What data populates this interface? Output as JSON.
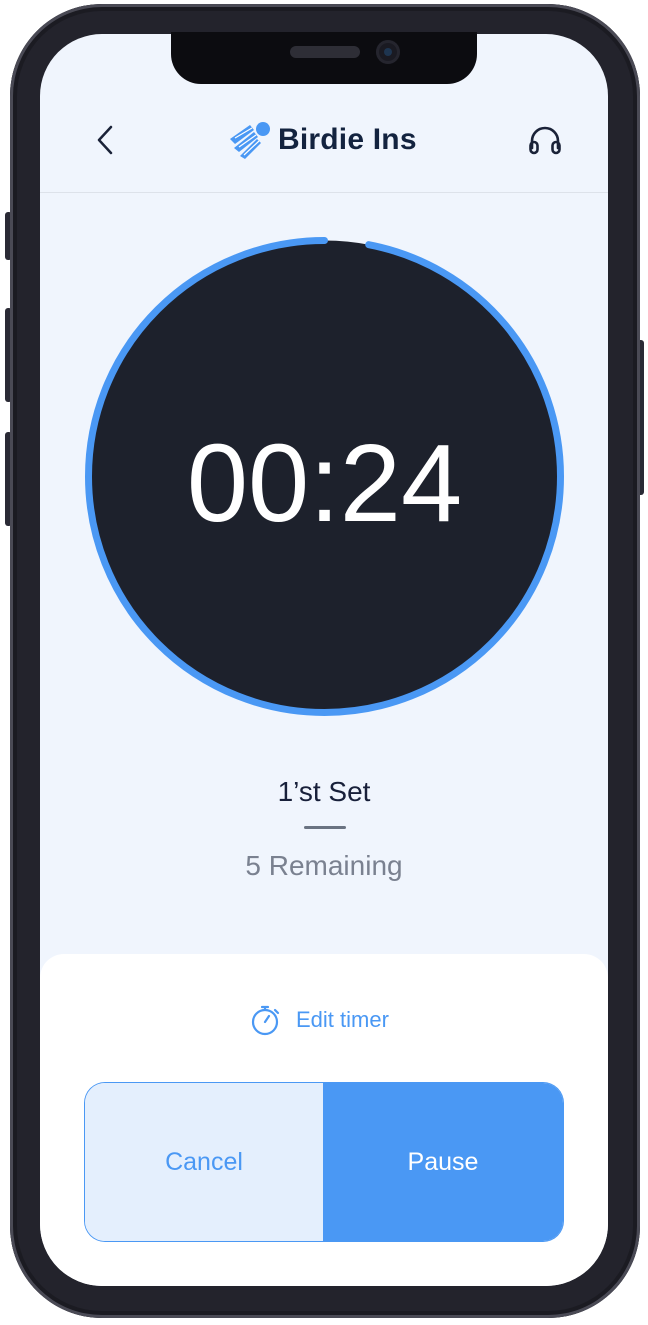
{
  "app": {
    "title": "Birdie Ins"
  },
  "header": {
    "back_icon": "chevron-left-icon",
    "logo_icon": "shuttlecock-icon",
    "right_icon": "headphones-icon"
  },
  "timer": {
    "display": "00:24",
    "progress": 0.97
  },
  "set": {
    "label": "1’st Set",
    "remaining": "5 Remaining"
  },
  "sheet": {
    "edit_timer_label": "Edit timer",
    "edit_timer_icon": "stopwatch-icon"
  },
  "buttons": {
    "cancel_label": "Cancel",
    "pause_label": "Pause"
  },
  "colors": {
    "accent": "#4a98f4",
    "dial": "#1d212c",
    "brand_text": "#13233f",
    "background": "#f0f5fd"
  }
}
